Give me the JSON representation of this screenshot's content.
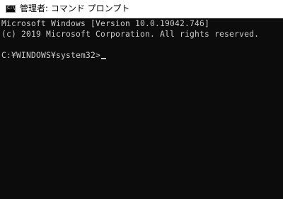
{
  "window": {
    "icon_name": "command-prompt-icon",
    "icon_label": "C:\\",
    "title": "管理者: コマンド プロンプト"
  },
  "console": {
    "lines": [
      "Microsoft Windows [Version 10.0.19042.746]",
      "(c) 2019 Microsoft Corporation. All rights reserved.",
      "",
      "C:¥WINDOWS¥system32>"
    ],
    "foreground": "#cccccc",
    "background": "#0c0c0c"
  }
}
